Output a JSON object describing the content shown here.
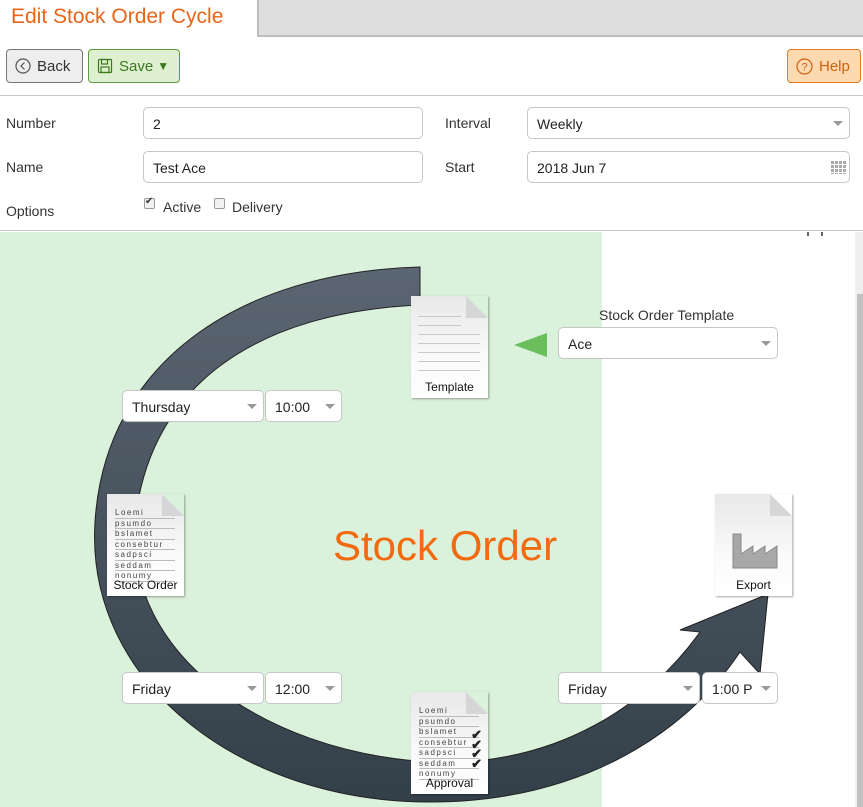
{
  "header": {
    "title": "Edit Stock Order Cycle"
  },
  "toolbar": {
    "back_label": "Back",
    "save_label": "Save",
    "help_label": "Help"
  },
  "form": {
    "number_label": "Number",
    "number_value": "2",
    "name_label": "Name",
    "name_value": "Test Ace",
    "options_label": "Options",
    "active_label": "Active",
    "active_checked": true,
    "delivery_label": "Delivery",
    "delivery_checked": false,
    "interval_label": "Interval",
    "interval_value": "Weekly",
    "start_label": "Start",
    "start_value": "2018 Jun 7"
  },
  "diagram": {
    "title": "Stock Order",
    "template_select_label": "Stock Order Template",
    "template_select_value": "Ace",
    "steps": {
      "template": "Template",
      "stock_order": "Stock Order",
      "approval": "Approval",
      "export": "Export"
    },
    "doc_text_lines": [
      "Loemi",
      "psumdo",
      "bslamet",
      "consebtur",
      "sadpsci",
      "seddam",
      "nonumy"
    ],
    "schedules": {
      "stock_order_day": "Thursday",
      "stock_order_time": "10:00",
      "approval_day": "Friday",
      "approval_time": "12:00",
      "export_day": "Friday",
      "export_time": "1:00 P"
    },
    "colors": {
      "accent": "#f26a10",
      "arc": "#4a5661",
      "panel_bg": "#daf1dc",
      "pointer_arrow": "#6abf5c"
    }
  }
}
